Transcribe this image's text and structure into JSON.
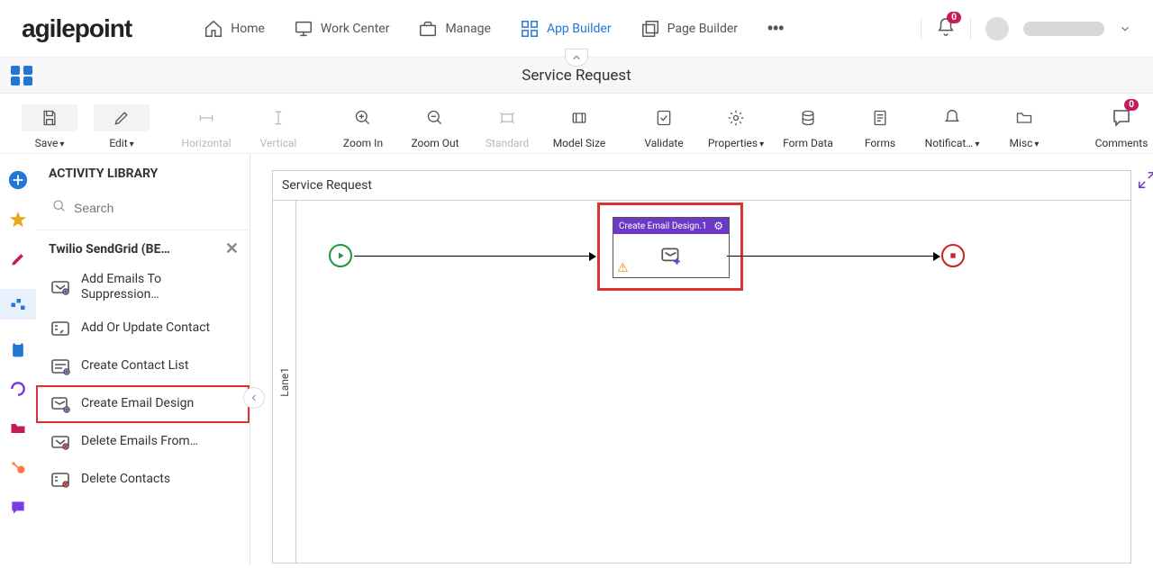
{
  "logo": "agilepoint",
  "nav": {
    "home": "Home",
    "work_center": "Work Center",
    "manage": "Manage",
    "app_builder": "App Builder",
    "page_builder": "Page Builder",
    "bell_badge": "0"
  },
  "titlebar": {
    "page_title": "Service Request"
  },
  "toolbar": {
    "save": "Save",
    "edit": "Edit",
    "horizontal": "Horizontal",
    "vertical": "Vertical",
    "zoom_in": "Zoom In",
    "zoom_out": "Zoom Out",
    "standard": "Standard",
    "model_size": "Model Size",
    "validate": "Validate",
    "properties": "Properties",
    "form_data": "Form Data",
    "forms": "Forms",
    "notifications": "Notificat…",
    "misc": "Misc",
    "comments": "Comments",
    "comments_badge": "0"
  },
  "library": {
    "header": "ACTIVITY LIBRARY",
    "search_placeholder": "Search",
    "category": "Twilio SendGrid (BE…",
    "items": [
      "Add Emails To Suppression…",
      "Add Or Update Contact",
      "Create Contact List",
      "Create Email Design",
      "Delete Emails From…",
      "Delete Contacts"
    ]
  },
  "canvas": {
    "process_name": "Service Request",
    "lane1": "Lane1",
    "activity_title": "Create Email Design.1"
  }
}
